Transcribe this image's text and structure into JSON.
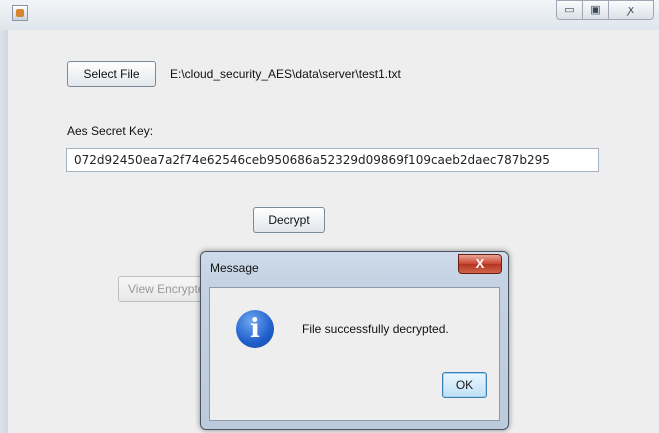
{
  "window": {
    "controls": {
      "minimize_glyph": "▭",
      "maximize_glyph": "▣",
      "close_glyph": "ꭗ"
    }
  },
  "main": {
    "select_file_label": "Select File",
    "file_path": "E:\\cloud_security_AES\\data\\server\\test1.txt",
    "secret_key_label": "Aes Secret Key:",
    "secret_key_value": "072d92450ea7a2f74e62546ceb950686a52329d09869f109caeb2daec787b295",
    "decrypt_label": "Decrypt",
    "view_encrypted_label": "View Encrypte"
  },
  "dialog": {
    "title": "Message",
    "close_glyph": "X",
    "icon_glyph": "i",
    "message": "File successfully decrypted.",
    "ok_label": "OK"
  },
  "colors": {
    "panel": "#eeeeee",
    "dialog_frame": "#c4d2e3",
    "close_red": "#c8452f",
    "info_blue": "#1f5fcc"
  }
}
